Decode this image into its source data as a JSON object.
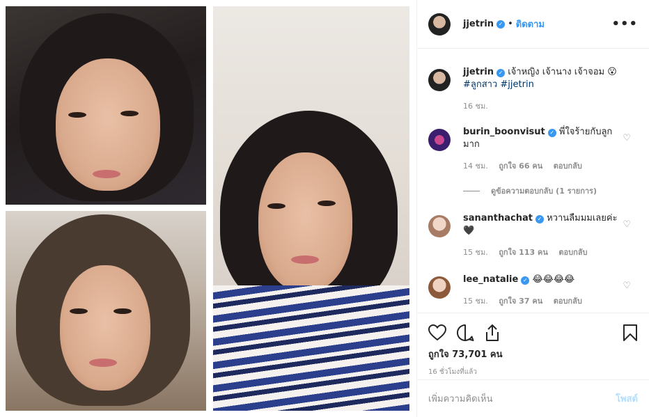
{
  "header": {
    "username": "jjetrin",
    "separator": "•",
    "follow_label": "ติดตาม",
    "more_label": "•••"
  },
  "caption": {
    "username": "jjetrin",
    "text": "เจ้าหญิง เจ้านาง เจ้าจอม 😮",
    "hashtags": "#ลูกสาว #jjetrin",
    "time": "16 ชม."
  },
  "comments": [
    {
      "username": "burin_boonvisut",
      "text": "พี่ใจร้ายกับลูกมาก",
      "time": "14 ชม.",
      "likes": "ถูกใจ 66 คน",
      "reply": "ตอบกลับ",
      "view_replies": "ดูข้อความตอบกลับ (1 รายการ)"
    },
    {
      "username": "sananthachat",
      "text": "หวานลืมมมเลยค่ะ 🖤",
      "time": "15 ชม.",
      "likes": "ถูกใจ 113 คน",
      "reply": "ตอบกลับ"
    },
    {
      "username": "lee_natalie",
      "text": "😂😂😂😂",
      "time": "15 ชม.",
      "likes": "ถูกใจ 37 คน",
      "reply": "ตอบกลับ"
    }
  ],
  "footer": {
    "likes_count": "ถูกใจ 73,701 คน",
    "time_ago": "16 ชั่วโมงที่แล้ว",
    "add_comment_placeholder": "เพิ่มความคิดเห็น",
    "post_label": "โพสต์"
  },
  "icons": [
    "heart-icon",
    "comment-icon",
    "share-icon",
    "bookmark-icon",
    "verified-icon"
  ],
  "colors": {
    "link_blue": "#3897f0",
    "muted": "#8e8e8e",
    "post_disabled": "#b2dffc"
  }
}
